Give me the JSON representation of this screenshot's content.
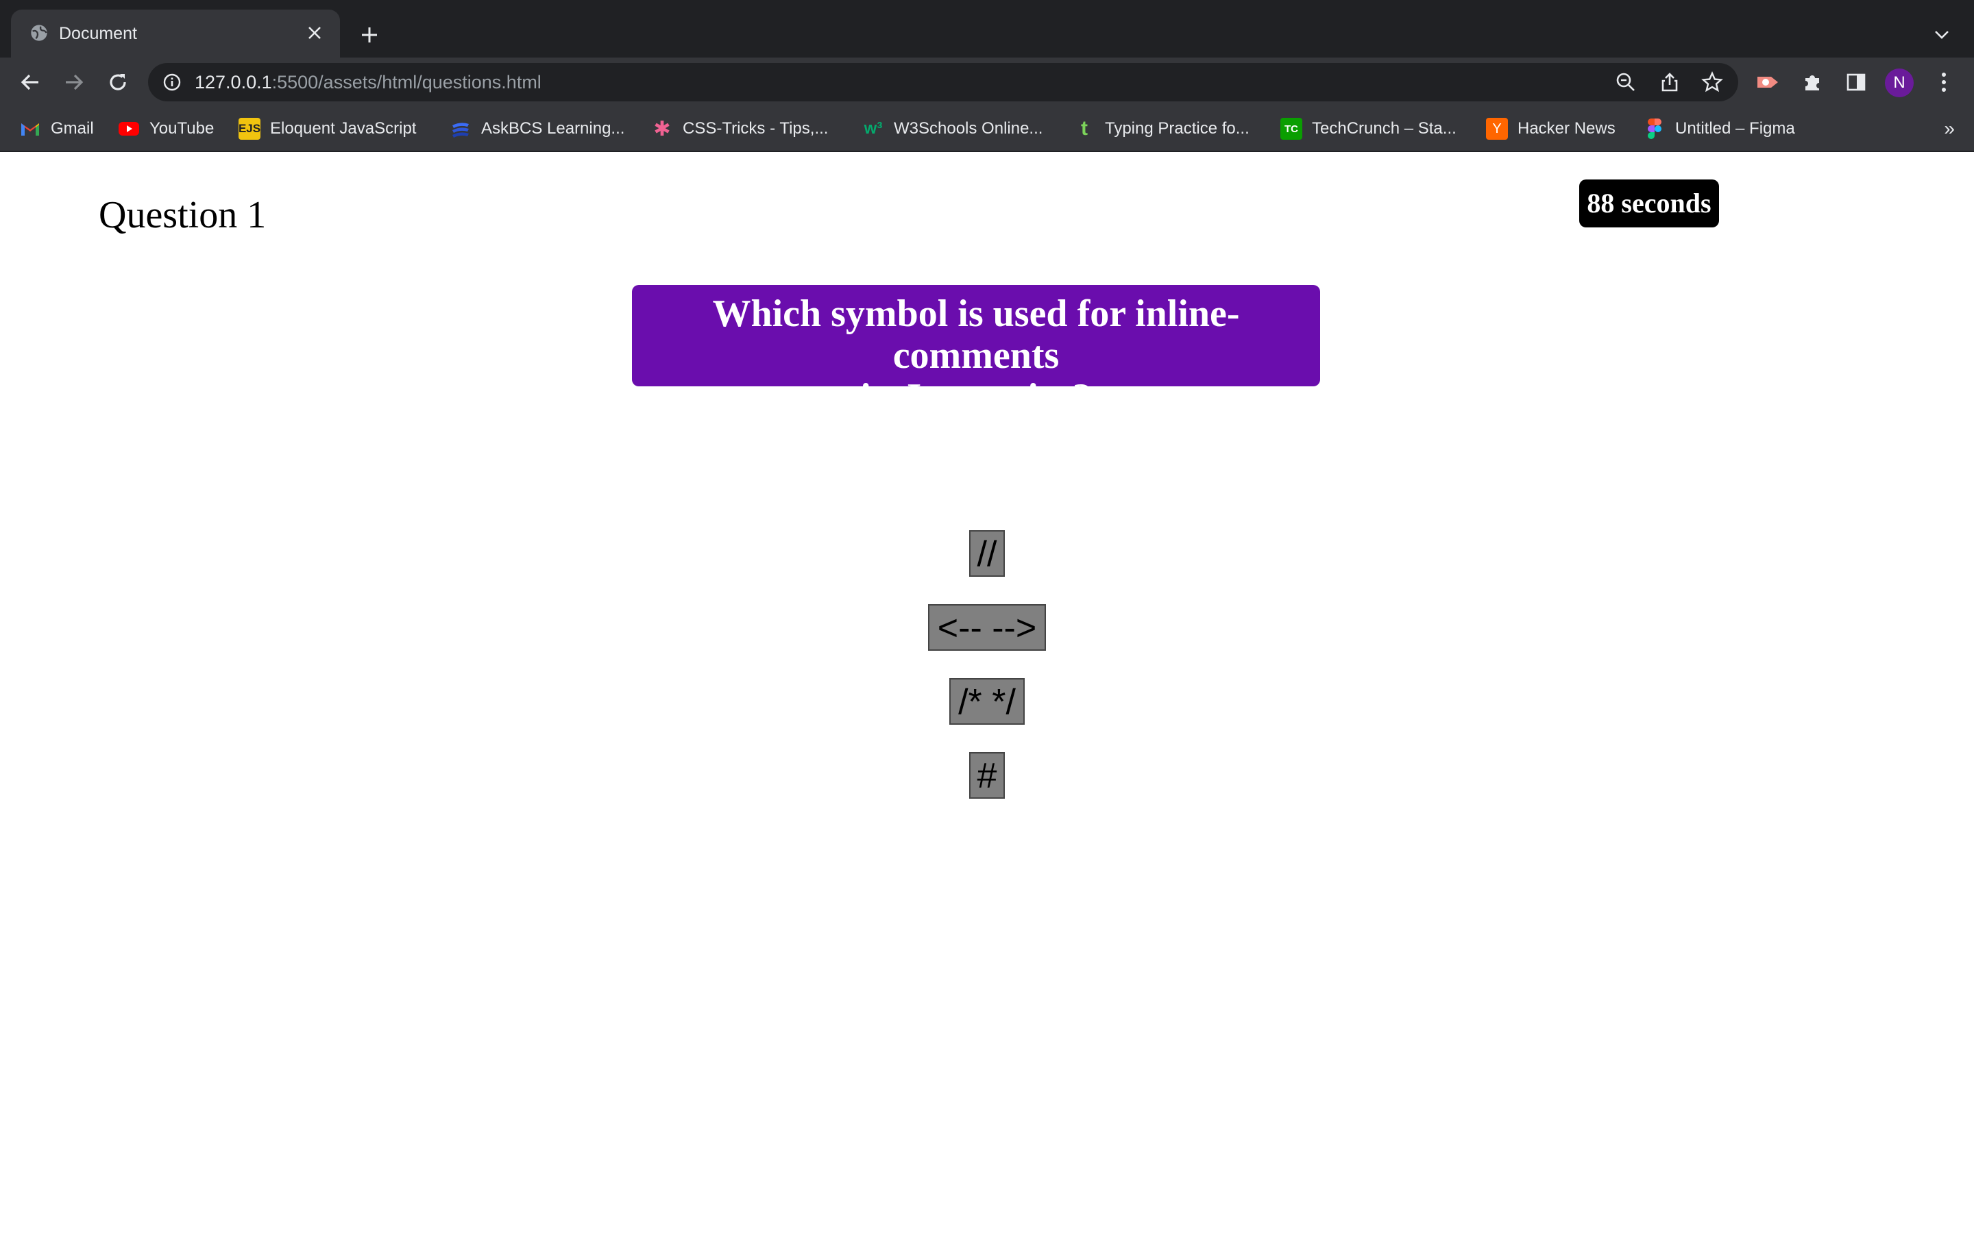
{
  "browser": {
    "tab": {
      "title": "Document",
      "icon": "globe-icon"
    },
    "url": {
      "host": "127.0.0.1",
      "path": ":5500/assets/html/questions.html"
    },
    "profile_initial": "N",
    "bookmarks": [
      {
        "label": "Gmail",
        "icon": "gmail-icon"
      },
      {
        "label": "YouTube",
        "icon": "youtube-icon"
      },
      {
        "label": "Eloquent JavaScript",
        "icon": "ejs-icon",
        "icon_text": "EJS"
      },
      {
        "label": "AskBCS Learning...",
        "icon": "askbcs-icon"
      },
      {
        "label": "CSS-Tricks - Tips,...",
        "icon": "css-tricks-icon",
        "icon_text": "✱"
      },
      {
        "label": "W3Schools Online...",
        "icon": "w3schools-icon",
        "icon_text": "w³"
      },
      {
        "label": "Typing Practice fo...",
        "icon": "typing-icon",
        "icon_text": "t"
      },
      {
        "label": "TechCrunch – Sta...",
        "icon": "techcrunch-icon",
        "icon_text": "TC"
      },
      {
        "label": "Hacker News",
        "icon": "hacker-news-icon",
        "icon_text": "Y"
      },
      {
        "label": "Untitled – Figma",
        "icon": "figma-icon"
      }
    ],
    "overflow": "»"
  },
  "quiz": {
    "question_number": "Question 1",
    "timer": "88 seconds",
    "question_line1": "Which symbol is used for inline-comments",
    "question_line2": "in Javascript?",
    "answers": [
      "//",
      "<-- -->",
      "/* */",
      "#"
    ]
  },
  "colors": {
    "question_bg": "#6a0dad",
    "timer_bg": "#000000",
    "answer_bg": "#808080"
  }
}
